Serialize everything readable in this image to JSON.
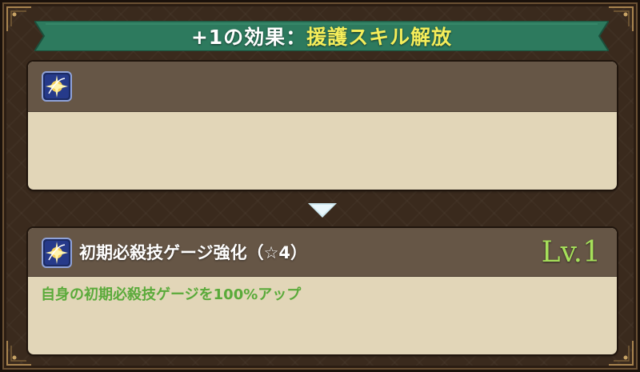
{
  "banner": {
    "prefix": "+1の効果：",
    "highlight": "援護スキル解放"
  },
  "before": {
    "icon": "support-skill-icon"
  },
  "transition_icon": "down-triangle-icon",
  "after": {
    "icon": "support-skill-icon",
    "name": "初期必殺技ゲージ強化（☆4）",
    "level": "Lv.1",
    "description": "自身の初期必殺技ゲージを100%アップ"
  },
  "colors": {
    "banner_bg": "#2d7a5e",
    "highlight_text": "#f5ee5a",
    "level_text": "#a6e05a",
    "description_text": "#5aaa3a",
    "panel_header": "#665646",
    "panel_body": "#e2d6b8"
  }
}
